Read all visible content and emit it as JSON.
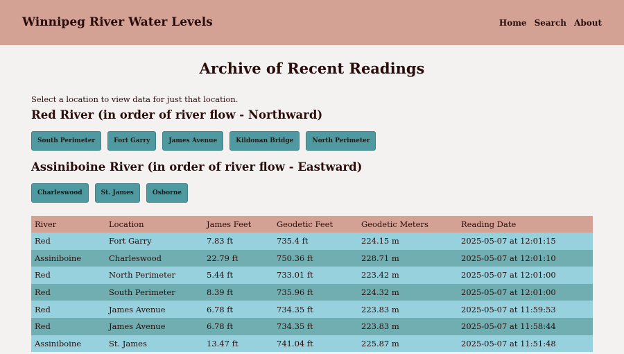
{
  "header": {
    "title": "Winnipeg River Water Levels",
    "nav": [
      "Home",
      "Search",
      "About"
    ]
  },
  "main": {
    "title": "Archive of Recent Readings",
    "intro": "Select a location to view data for just that location.",
    "red_heading": "Red River (in order of river flow - Northward)",
    "red_locations": [
      "South Perimeter",
      "Fort Garry",
      "James Avenue",
      "Kildonan Bridge",
      "North Perimeter"
    ],
    "assiniboine_heading": "Assiniboine River (in order of river flow - Eastward)",
    "assiniboine_locations": [
      "Charleswood",
      "St. James",
      "Osborne"
    ]
  },
  "table": {
    "columns": [
      "River",
      "Location",
      "James Feet",
      "Geodetic Feet",
      "Geodetic Meters",
      "Reading Date"
    ],
    "rows": [
      [
        "Red",
        "Fort Garry",
        "7.83 ft",
        "735.4 ft",
        "224.15 m",
        "2025-05-07 at 12:01:15"
      ],
      [
        "Assiniboine",
        "Charleswood",
        "22.79 ft",
        "750.36 ft",
        "228.71 m",
        "2025-05-07 at 12:01:10"
      ],
      [
        "Red",
        "North Perimeter",
        "5.44 ft",
        "733.01 ft",
        "223.42 m",
        "2025-05-07 at 12:01:00"
      ],
      [
        "Red",
        "South Perimeter",
        "8.39 ft",
        "735.96 ft",
        "224.32 m",
        "2025-05-07 at 12:01:00"
      ],
      [
        "Red",
        "James Avenue",
        "6.78 ft",
        "734.35 ft",
        "223.83 m",
        "2025-05-07 at 11:59:53"
      ],
      [
        "Red",
        "James Avenue",
        "6.78 ft",
        "734.35 ft",
        "223.83 m",
        "2025-05-07 at 11:58:44"
      ],
      [
        "Assiniboine",
        "St. James",
        "13.47 ft",
        "741.04 ft",
        "225.87 m",
        "2025-05-07 at 11:51:48"
      ]
    ]
  },
  "colors": {
    "header_bg": "#d4a294",
    "button_bg": "#4e9aa0",
    "row_light": "#96d1dd",
    "row_dark": "#70aeb2"
  }
}
